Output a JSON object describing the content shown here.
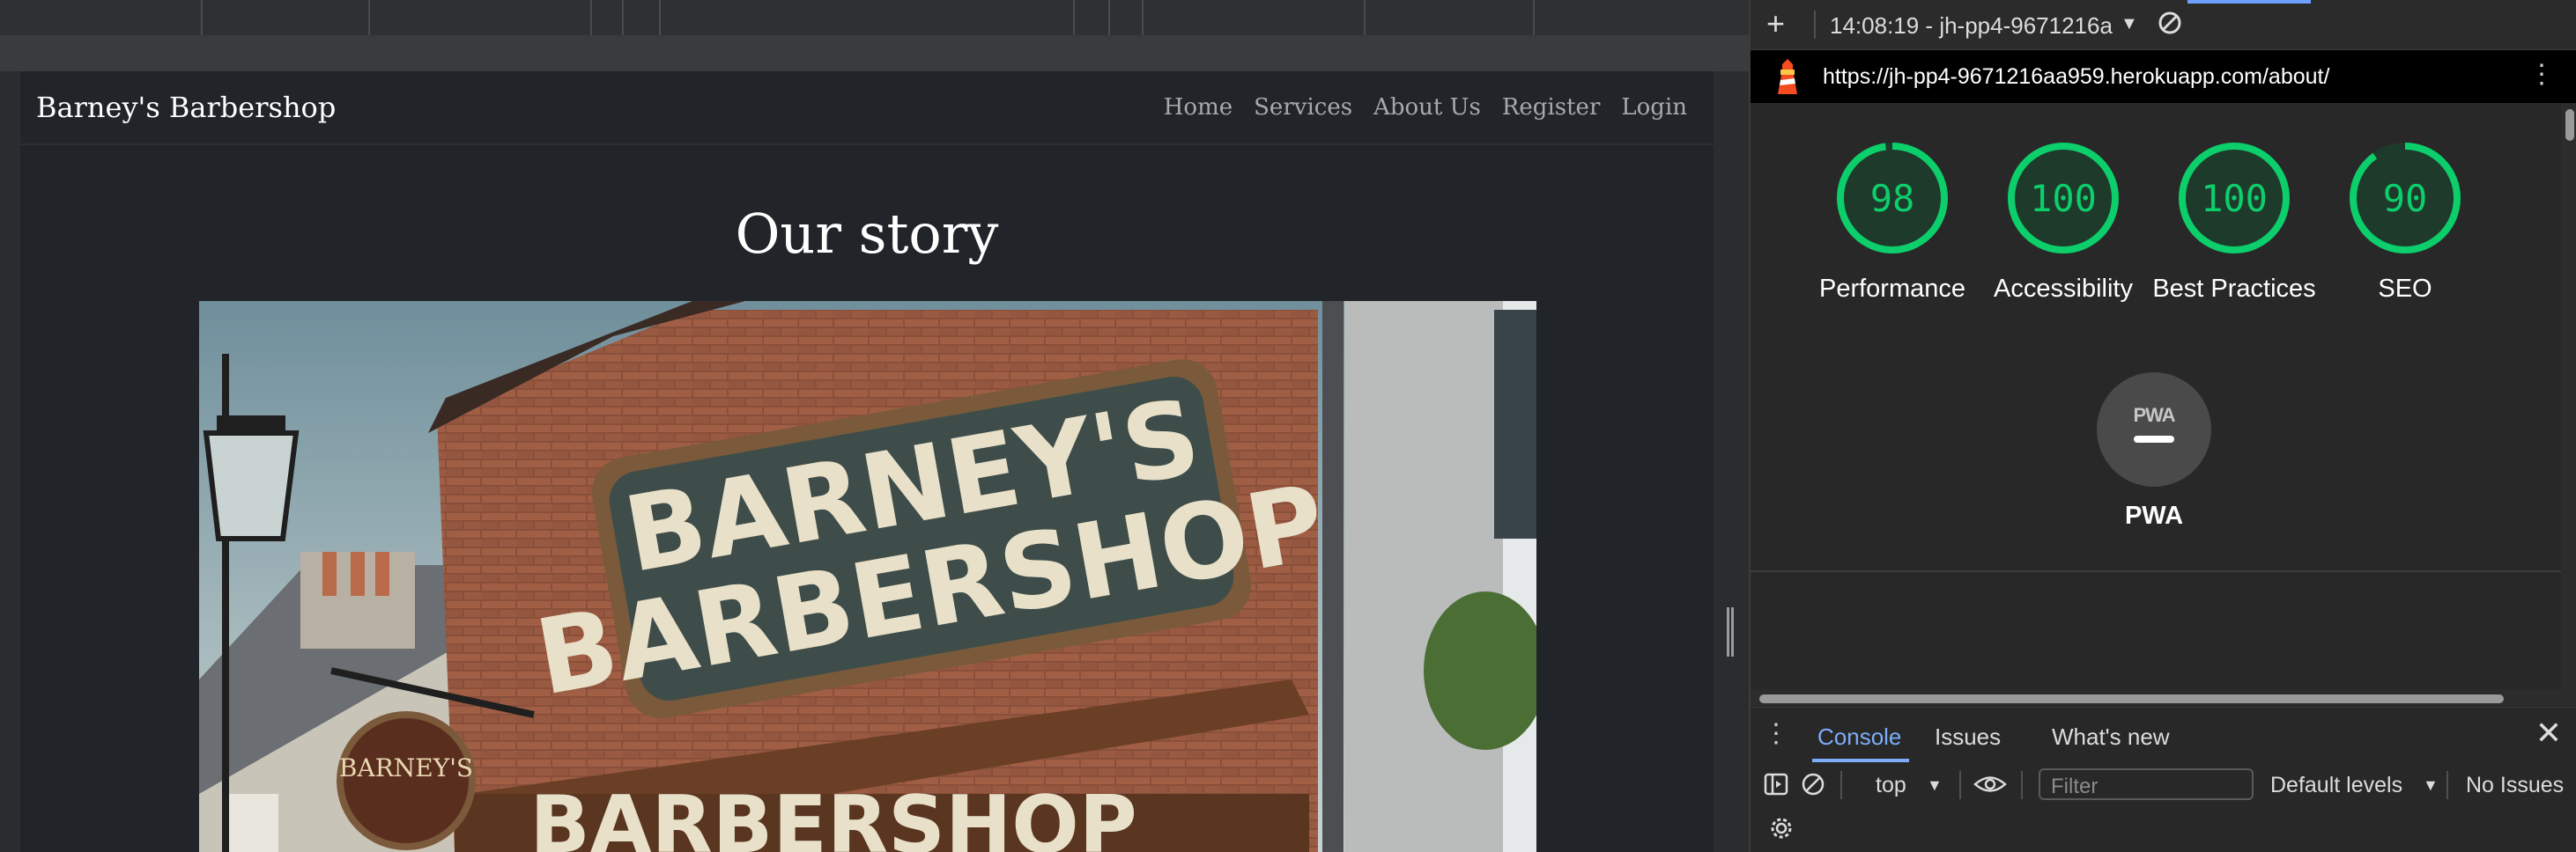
{
  "site": {
    "brand": "Barney's Barbershop",
    "nav": [
      "Home",
      "Services",
      "About Us",
      "Register",
      "Login"
    ],
    "heading": "Our story",
    "hero_sign_line1": "BARNEY'S",
    "hero_sign_line2": "BARBERSHOP",
    "hero_lower_sign": "BARBERSHOP",
    "hero_hanging_sign": "BARNEY'S"
  },
  "devtools": {
    "session": "14:08:19 - jh-pp4-9671216a",
    "url": "https://jh-pp4-9671216aa959.herokuapp.com/about/",
    "scores": [
      {
        "value": "98",
        "label": "Performance"
      },
      {
        "value": "100",
        "label": "Accessibility"
      },
      {
        "value": "100",
        "label": "Best Practices"
      },
      {
        "value": "90",
        "label": "SEO"
      }
    ],
    "pwa": {
      "badge": "PWA",
      "label": "PWA"
    },
    "drawer_tabs": [
      "Console",
      "Issues",
      "What's new"
    ],
    "console": {
      "context": "top",
      "filter_placeholder": "Filter",
      "levels": "Default levels",
      "issues": "No Issues"
    },
    "accent_color": "#0cce6b"
  }
}
